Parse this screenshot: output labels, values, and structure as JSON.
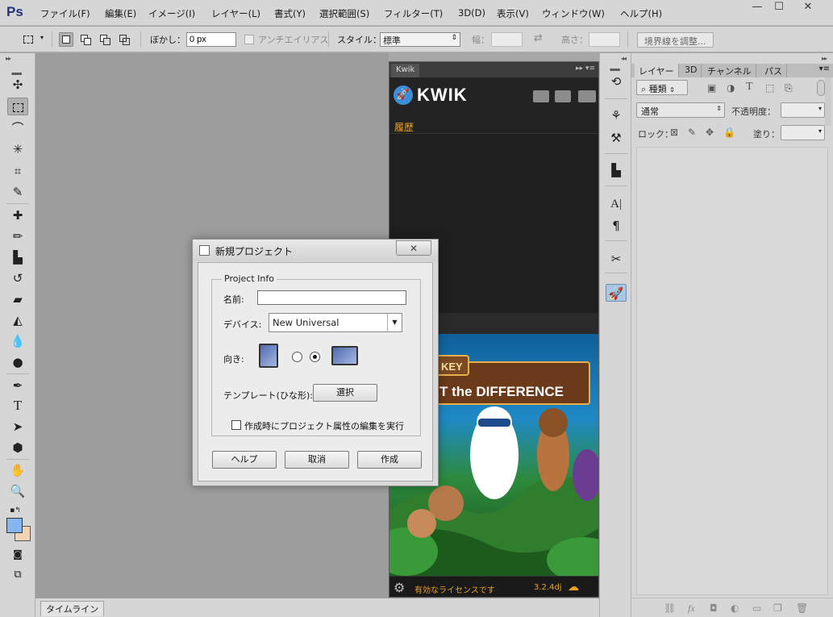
{
  "app": {
    "logo": "Ps",
    "menu": [
      "ファイル(F)",
      "編集(E)",
      "イメージ(I)",
      "レイヤー(L)",
      "書式(Y)",
      "選択範囲(S)",
      "フィルター(T)",
      "3D(D)",
      "表示(V)",
      "ウィンドウ(W)",
      "ヘルプ(H)"
    ],
    "window_buttons": [
      "—",
      "☐",
      "✕"
    ]
  },
  "options": {
    "feather_label": "ぼかし：",
    "feather_value": "0 px",
    "antialias_label": "アンチエイリアス",
    "style_label": "スタイル：",
    "style_value": "標準",
    "width_label": "幅：",
    "height_label": "高さ：",
    "refine_button": "境界線を調整..."
  },
  "canvas": {
    "timeline_tab": "タイムライン"
  },
  "kwik": {
    "tab": "Kwik",
    "title": "KWIK",
    "history": "履歴",
    "license": "有効なライセンスです",
    "version": "3.2.4dj"
  },
  "layers": {
    "tabs": [
      "レイヤー",
      "3D",
      "チャンネル",
      "パス"
    ],
    "kind_filter": "種類",
    "blend_mode": "通常",
    "opacity_label": "不透明度：",
    "lock_label": "ロック：",
    "fill_label": "塗り："
  },
  "dialog": {
    "title": "新規プロジェクト",
    "group_label": "Project Info",
    "name_label": "名前:",
    "name_value": "",
    "device_label": "デバイス:",
    "device_value": "New Universal",
    "orientation_label": "向き:",
    "orientation_selected": "landscape",
    "template_label": "テンプレート(ひな形):",
    "template_button": "選択",
    "checkbox_label": "作成時にプロジェクト属性の編集を実行",
    "checkbox_checked": false,
    "help_button": "ヘルプ",
    "cancel_button": "取消",
    "create_button": "作成"
  },
  "artwork_text": {
    "line1": "KEY",
    "line2": "T the DIFFERENCE"
  },
  "colors": {
    "kwik_accent": "#f0a11f",
    "ps_logo": "#26327a",
    "foreground_swatch": "#86b6f0",
    "background_swatch": "#f1d4b5"
  }
}
